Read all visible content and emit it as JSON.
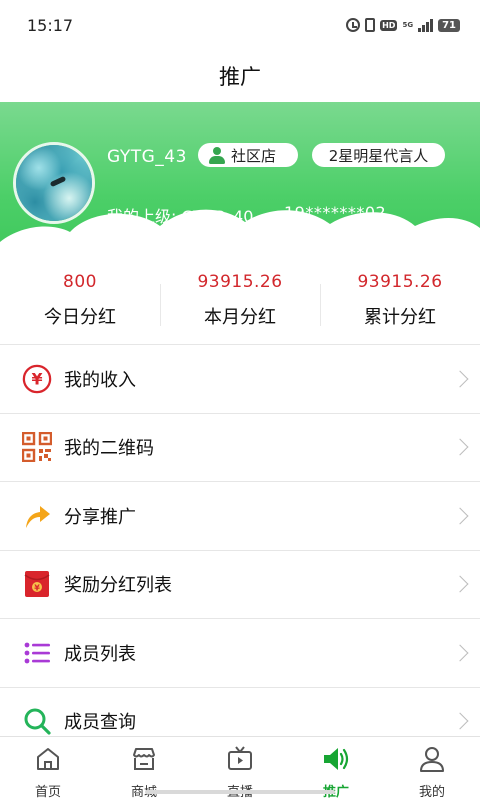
{
  "status_bar": {
    "time": "15:17",
    "hd_label": "HD",
    "network_label": "5G",
    "battery": "71"
  },
  "header": {
    "title": "推广"
  },
  "profile": {
    "username": "GYTG_43",
    "store_badge": "社区店",
    "rank_badge": "2星明星代言人",
    "superior_label": "我的上级: GYTG_40",
    "superior_phone": "19*******02",
    "accent_green": "#4ccf68"
  },
  "stats": [
    {
      "value": "800",
      "label": "今日分红"
    },
    {
      "value": "93915.26",
      "label": "本月分红"
    },
    {
      "value": "93915.26",
      "label": "累计分红"
    }
  ],
  "menu": [
    {
      "label": "我的收入",
      "icon": "yuan-circle-icon"
    },
    {
      "label": "我的二维码",
      "icon": "qr-code-icon"
    },
    {
      "label": "分享推广",
      "icon": "share-arrow-icon"
    },
    {
      "label": "奖励分红列表",
      "icon": "red-envelope-icon"
    },
    {
      "label": "成员列表",
      "icon": "list-icon"
    },
    {
      "label": "成员查询",
      "icon": "search-icon"
    }
  ],
  "bottom_nav": [
    {
      "label": "首页",
      "icon": "home-icon",
      "active": false
    },
    {
      "label": "商城",
      "icon": "shop-icon",
      "active": false
    },
    {
      "label": "直播",
      "icon": "tv-icon",
      "active": false
    },
    {
      "label": "推广",
      "icon": "megaphone-icon",
      "active": true
    },
    {
      "label": "我的",
      "icon": "user-icon",
      "active": false
    }
  ],
  "colors": {
    "stat_value": "#d2272c",
    "active_nav": "#17a533"
  }
}
